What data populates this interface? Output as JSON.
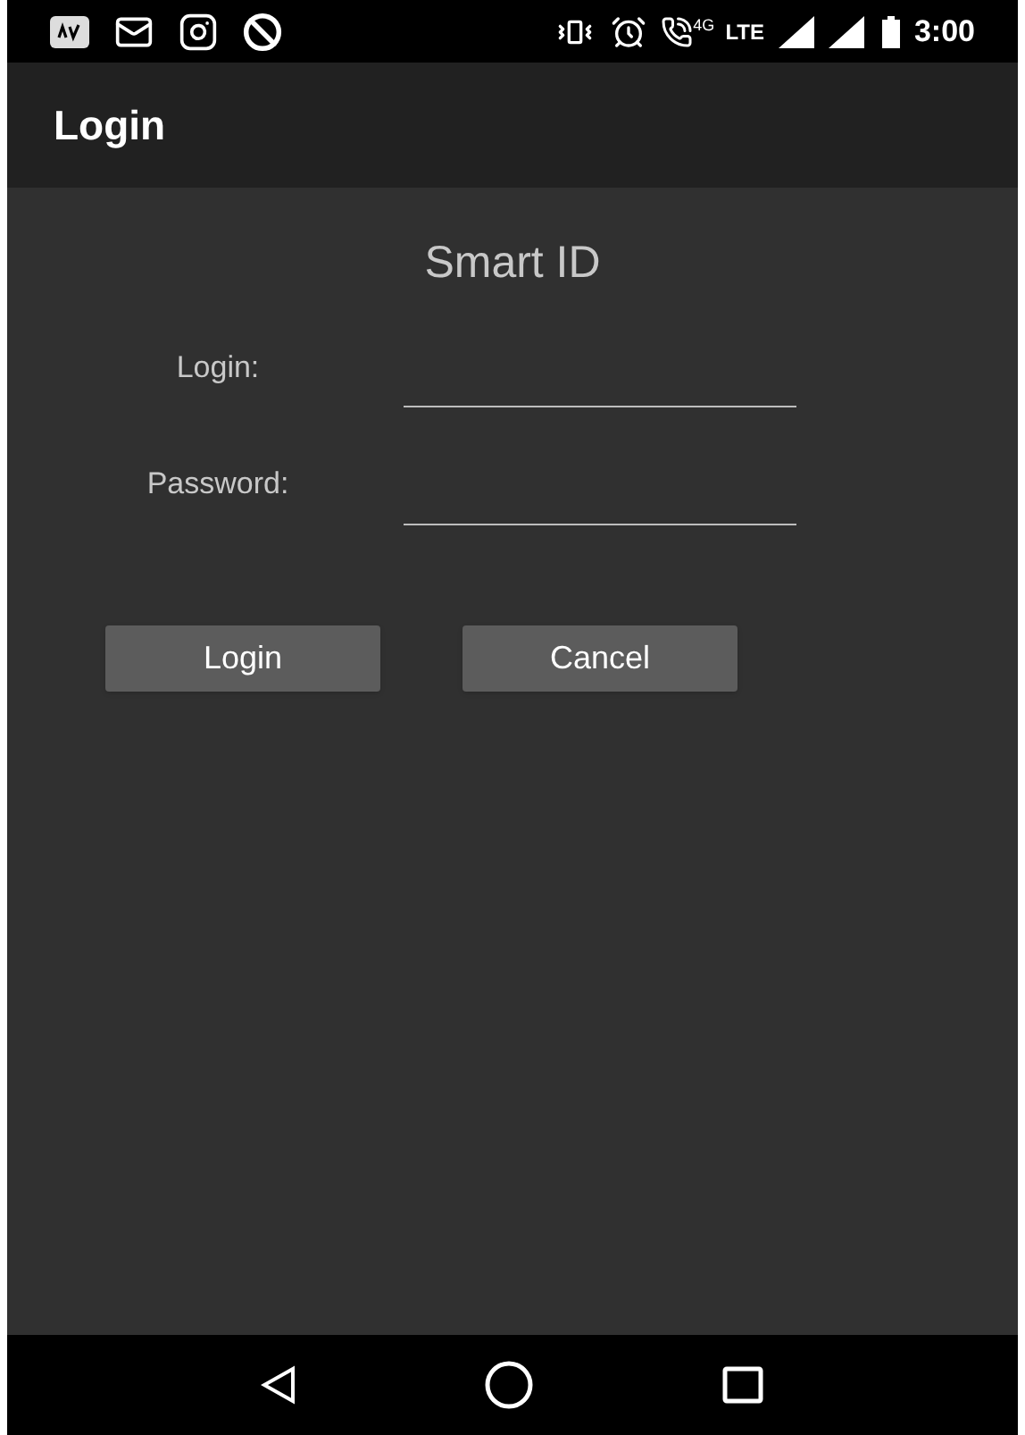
{
  "status_bar": {
    "network_label": "4G",
    "lte_label": "LTE",
    "time": "3:00"
  },
  "app_bar": {
    "title": "Login"
  },
  "form": {
    "heading": "Smart ID",
    "fields": [
      {
        "label": "Login:"
      },
      {
        "label": "Password:"
      }
    ],
    "buttons": [
      "Login",
      "Cancel"
    ]
  }
}
